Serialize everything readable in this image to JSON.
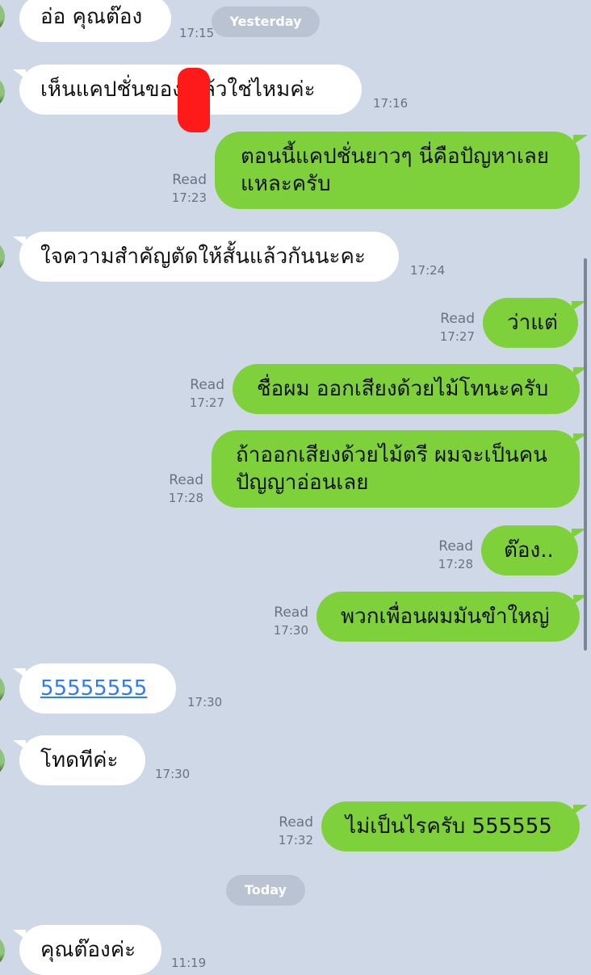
{
  "dates": {
    "yesterday": "Yesterday",
    "today": "Today"
  },
  "messages": [
    {
      "id": "m1",
      "side": "in",
      "text": "อ่อ คุณต๊อง",
      "time": "17:15"
    },
    {
      "id": "m2",
      "side": "in",
      "text": "เห็นแคปชั่นของ  แล้วใช่ไหมค่ะ",
      "time": "17:16"
    },
    {
      "id": "m3",
      "side": "out",
      "lines": [
        "ตอนนี้แคปชั่นยาวๆ นี่คือปัญหาเลย",
        "แหละครับ"
      ],
      "read": "Read",
      "time": "17:23"
    },
    {
      "id": "m4",
      "side": "in",
      "text": "ใจความสำคัญตัดให้สั้นแล้วกันนะคะ",
      "time": "17:24"
    },
    {
      "id": "m5",
      "side": "out",
      "text": "ว่าแต่",
      "read": "Read",
      "time": "17:27"
    },
    {
      "id": "m6",
      "side": "out",
      "text": "ชื่อผม ออกเสียงด้วยไม้โทนะครับ",
      "read": "Read",
      "time": "17:27"
    },
    {
      "id": "m7",
      "side": "out",
      "lines": [
        "ถ้าออกเสียงด้วยไม้ตรี ผมจะเป็นคน",
        "ปัญญาอ่อนเลย"
      ],
      "read": "Read",
      "time": "17:28"
    },
    {
      "id": "m8",
      "side": "out",
      "text": "ต๊อง..",
      "read": "Read",
      "time": "17:28"
    },
    {
      "id": "m9",
      "side": "out",
      "text": "พวกเพื่อนผมมันขำใหญ่",
      "read": "Read",
      "time": "17:30"
    },
    {
      "id": "m10",
      "side": "in",
      "text": "55555555",
      "time": "17:30"
    },
    {
      "id": "m11",
      "side": "in",
      "text": "โทดทีค่ะ",
      "time": "17:30"
    },
    {
      "id": "m12",
      "side": "out",
      "text": "ไม่เป็นไรครับ 555555",
      "read": "Read",
      "time": "17:32"
    },
    {
      "id": "m13",
      "side": "in",
      "text": "คุณต๊องค่ะ",
      "time": "11:19"
    }
  ],
  "colors": {
    "background": "#cfd8e6",
    "incoming": "#ffffff",
    "outgoing": "#7fd13b",
    "link": "#2e7cf6"
  }
}
